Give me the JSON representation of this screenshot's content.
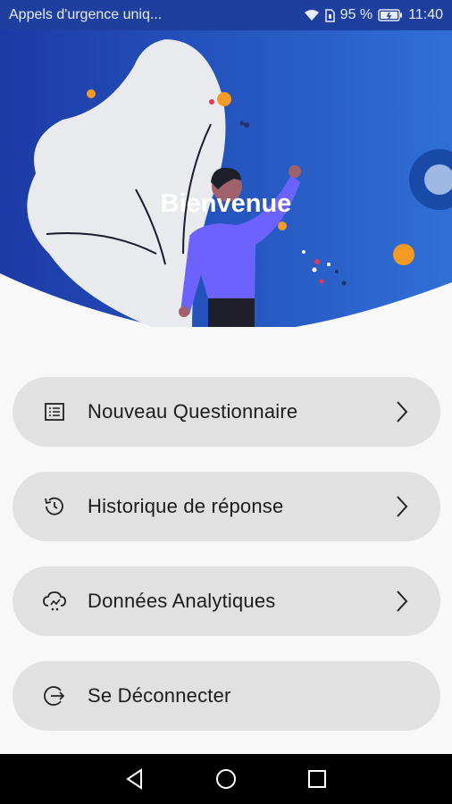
{
  "status_bar": {
    "notification_text": "Appels d'urgence uniq...",
    "battery": "95 %",
    "time": "11:40"
  },
  "hero": {
    "title": "Bienvenue"
  },
  "menu": {
    "items": [
      {
        "label": "Nouveau Questionnaire",
        "icon": "questionnaire-icon"
      },
      {
        "label": "Historique de réponse",
        "icon": "history-icon"
      },
      {
        "label": "Données Analytiques",
        "icon": "analytics-icon"
      },
      {
        "label": "Se Déconnecter",
        "icon": "logout-icon"
      }
    ]
  },
  "colors": {
    "hero_gradient_start": "#1c3aa6",
    "hero_gradient_end": "#2f6fd6",
    "menu_item_bg": "#e1e1e1",
    "accent_star": "#f59a23"
  }
}
